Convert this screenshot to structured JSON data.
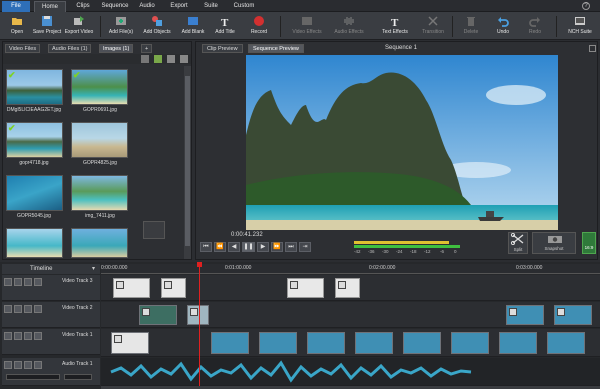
{
  "menu": {
    "file": "File",
    "home": "Home",
    "clips": "Clips",
    "sequence": "Sequence",
    "audio": "Audio",
    "export": "Export",
    "suite": "Suite",
    "custom": "Custom"
  },
  "toolbar": {
    "open": "Open",
    "save_project": "Save Project",
    "export_video": "Export Video",
    "add_files": "Add File(s)",
    "add_objects": "Add Objects",
    "add_blank": "Add Blank",
    "add_title": "Add Title",
    "record": "Record",
    "video_effects": "Video Effects",
    "audio_effects": "Audio Effects",
    "text_effects": "Text Effects",
    "transition": "Transition",
    "delete": "Delete",
    "undo": "Undo",
    "redo": "Redo",
    "nch_suite": "NCH Suite"
  },
  "library": {
    "tabs": [
      "Video Files",
      "Audio Files",
      "Images"
    ],
    "audio_count": "(1)",
    "images_count": "(1)",
    "add_tab": "+",
    "items": [
      {
        "label": "DMgl5LICIEAAG2ET.jpg",
        "checked": true
      },
      {
        "label": "GOPR0691.jpg",
        "checked": true
      },
      {
        "label": "gopr4718.jpg",
        "checked": true
      },
      {
        "label": "GOPR4825.jpg",
        "checked": false
      },
      {
        "label": "GOPR5045.jpg",
        "checked": false
      },
      {
        "label": "img_7411.jpg",
        "checked": false
      },
      {
        "label": "",
        "checked": false
      },
      {
        "label": "",
        "checked": false
      }
    ]
  },
  "preview": {
    "tabs": [
      "Clip Preview",
      "Sequence Preview"
    ],
    "title": "Sequence 1",
    "timecode": "0:00:41.232",
    "meter_labels": [
      "-42",
      "-36",
      "-30",
      "-24",
      "-18",
      "-12",
      "-6",
      "0"
    ],
    "split_label": "Split",
    "snapshot_label": "Snapshot",
    "ratio_label": "16:9"
  },
  "timeline": {
    "label": "Timeline",
    "ruler": [
      "0:00:00.000",
      "0:01:00.000",
      "0:02:00.000",
      "0:03:00.000"
    ],
    "tracks": [
      "Video Track 3",
      "Video Track 2",
      "Video Track 1",
      "Audio Track 1"
    ]
  },
  "colors": {
    "accent": "#2e6fb8",
    "record": "#d33030",
    "playhead": "#e02020",
    "meter_green": "#3fbf3f",
    "meter_yellow": "#e0c030",
    "waveform": "#3aa6c8"
  }
}
